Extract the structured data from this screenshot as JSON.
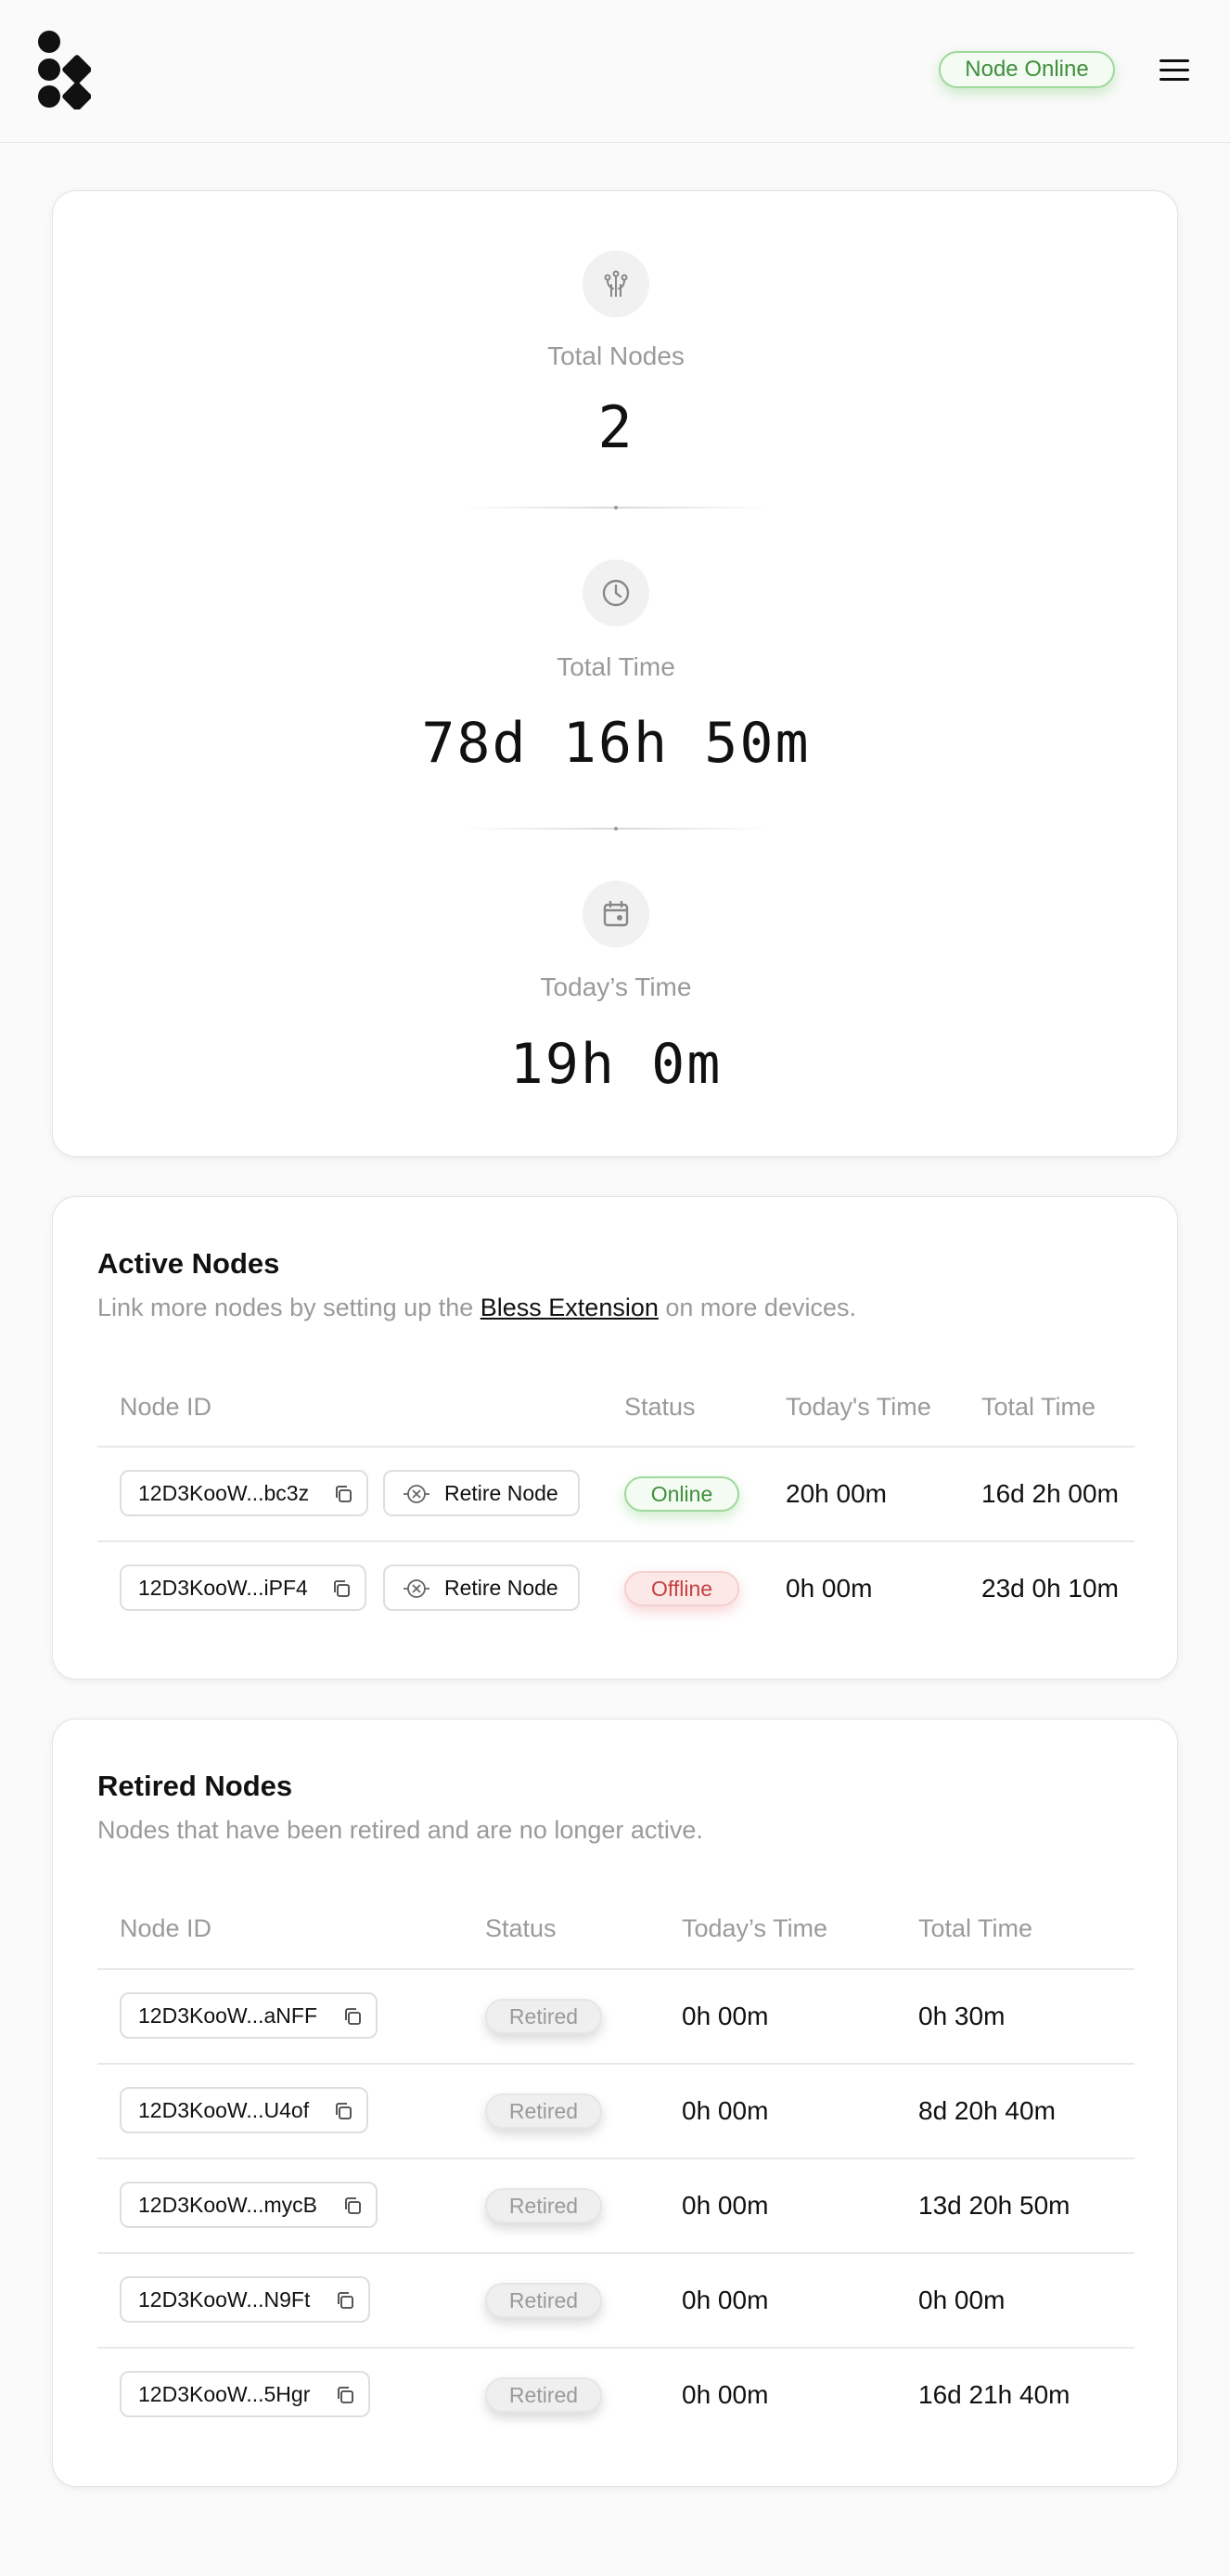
{
  "header": {
    "status_label": "Node Online",
    "status_color": "#3f8f3c",
    "logo_icon": "bless-logo-icon",
    "menu_icon": "hamburger-menu-icon"
  },
  "stats": {
    "total_nodes": {
      "label": "Total Nodes",
      "value": "2",
      "icon": "node-network-icon"
    },
    "total_time": {
      "label": "Total Time",
      "value": "78d 16h 50m",
      "icon": "clock-icon"
    },
    "todays_time": {
      "label": "Today’s Time",
      "value": "19h 0m",
      "icon": "calendar-icon"
    }
  },
  "active_nodes": {
    "title": "Active Nodes",
    "subtitle_before": "Link more nodes by setting up the ",
    "subtitle_link": "Bless Extension",
    "subtitle_after": " on more devices.",
    "columns": [
      "Node ID",
      "Status",
      "Today's Time",
      "Total Time"
    ],
    "retire_label": "Retire Node",
    "rows": [
      {
        "node_id": "12D3KooW...bc3z",
        "status": "Online",
        "today": "20h 00m",
        "total": "16d 2h 00m"
      },
      {
        "node_id": "12D3KooW...iPF4",
        "status": "Offline",
        "today": "0h 00m",
        "total": "23d 0h 10m"
      }
    ]
  },
  "retired_nodes": {
    "title": "Retired Nodes",
    "subtitle": "Nodes that have been retired and are no longer active.",
    "columns": [
      "Node ID",
      "Status",
      "Today’s Time",
      "Total Time"
    ],
    "rows": [
      {
        "node_id": "12D3KooW...aNFF",
        "status": "Retired",
        "today": "0h 00m",
        "total": "0h 30m"
      },
      {
        "node_id": "12D3KooW...U4of",
        "status": "Retired",
        "today": "0h 00m",
        "total": "8d 20h 40m"
      },
      {
        "node_id": "12D3KooW...mycB",
        "status": "Retired",
        "today": "0h 00m",
        "total": "13d 20h 50m"
      },
      {
        "node_id": "12D3KooW...N9Ft",
        "status": "Retired",
        "today": "0h 00m",
        "total": "0h 00m"
      },
      {
        "node_id": "12D3KooW...5Hgr",
        "status": "Retired",
        "today": "0h 00m",
        "total": "16d 21h 40m"
      }
    ]
  }
}
